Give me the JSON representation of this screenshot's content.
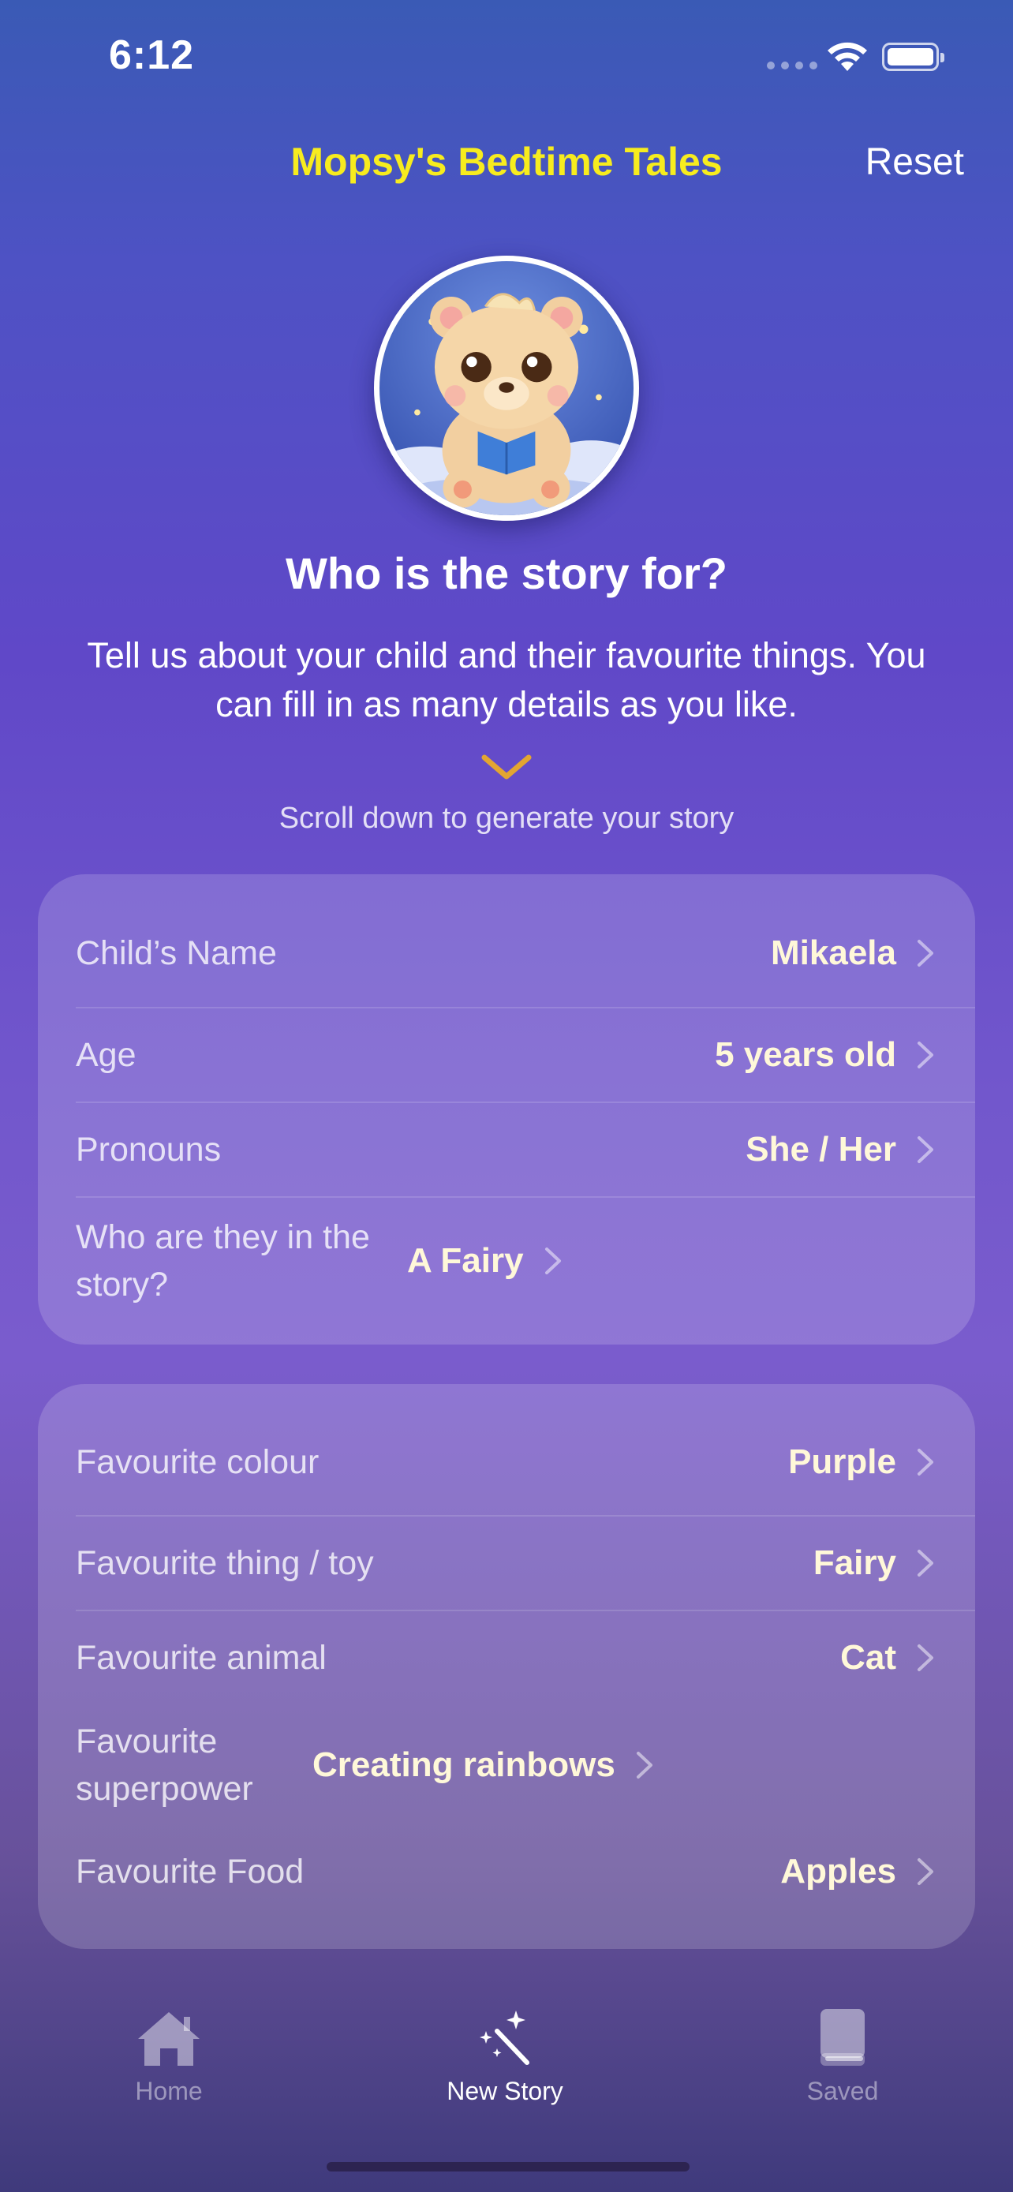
{
  "status_bar": {
    "time": "6:12"
  },
  "nav": {
    "title": "Mopsy's Bedtime Tales",
    "reset_label": "Reset"
  },
  "header": {
    "heading": "Who is the story for?",
    "subtext": "Tell us about your child and their favourite things. You can fill in as many details as you like.",
    "scroll_hint": "Scroll down to generate your story"
  },
  "child_details": [
    {
      "label": "Child’s Name",
      "value": "Mikaela"
    },
    {
      "label": "Age",
      "value": "5 years old"
    },
    {
      "label": "Pronouns",
      "value": "She / Her"
    },
    {
      "label": "Who are they in the story?",
      "value": "A Fairy"
    }
  ],
  "favourites": [
    {
      "label": "Favourite colour",
      "value": "Purple"
    },
    {
      "label": "Favourite thing / toy",
      "value": "Fairy"
    },
    {
      "label": "Favourite animal",
      "value": "Cat"
    },
    {
      "label": "Favourite superpower",
      "value": "Creating rainbows"
    },
    {
      "label": "Favourite Food",
      "value": "Apples"
    }
  ],
  "tab_bar": {
    "home_label": "Home",
    "new_story_label": "New Story",
    "saved_label": "Saved",
    "active_tab": "New Story"
  },
  "colors": {
    "title_yellow": "#f7ec1e",
    "value_text": "#fff8d9",
    "hint_chevron": "#e3a531"
  }
}
